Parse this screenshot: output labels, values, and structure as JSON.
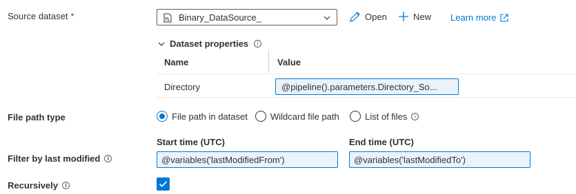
{
  "source_dataset": {
    "label": "Source dataset",
    "required_mark": "*",
    "selected": "Binary_DataSource_",
    "open_label": "Open",
    "new_label": "New",
    "learn_more_label": "Learn more"
  },
  "dataset_properties": {
    "title": "Dataset properties",
    "columns": [
      "Name",
      "Value"
    ],
    "rows": [
      {
        "name": "Directory",
        "value": "@pipeline().parameters.Directory_So..."
      }
    ]
  },
  "file_path_type": {
    "label": "File path type",
    "options": [
      "File path in dataset",
      "Wildcard file path",
      "List of files"
    ],
    "selected_index": 0
  },
  "filter": {
    "label": "Filter by last modified",
    "start_label": "Start time (UTC)",
    "start_value": "@variables('lastModifiedFrom')",
    "end_label": "End time (UTC)",
    "end_value": "@variables('lastModifiedTo')"
  },
  "recursively": {
    "label": "Recursively",
    "checked": true
  },
  "icons": {
    "info": "i",
    "accent_color": "#0078d4"
  }
}
